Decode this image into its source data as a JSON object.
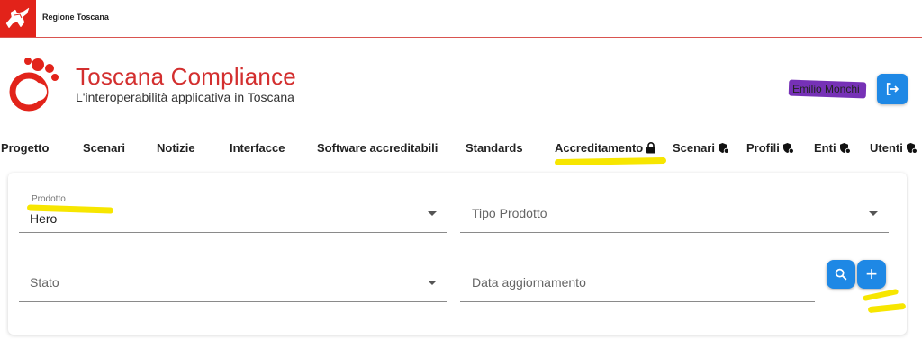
{
  "header": {
    "region_name": "Regione Toscana",
    "region_logo_icon": "pegasus-icon",
    "brand_title": "Toscana Compliance",
    "brand_subtitle": "L'interoperabilità applicativa in Toscana",
    "user_name": "Emilio Monchi"
  },
  "nav": {
    "items": [
      {
        "label": "Progetto"
      },
      {
        "label": "Scenari"
      },
      {
        "label": "Notizie"
      },
      {
        "label": "Interfacce"
      },
      {
        "label": "Software accreditabili"
      },
      {
        "label": "Standards"
      },
      {
        "label": "Accreditamento",
        "icon": "lock-icon"
      },
      {
        "label": "Scenari",
        "icon": "shield-icon"
      },
      {
        "label": "Profili",
        "icon": "shield-icon"
      },
      {
        "label": "Enti",
        "icon": "shield-icon"
      },
      {
        "label": "Utenti",
        "icon": "shield-icon"
      }
    ]
  },
  "filters": {
    "prodotto_label": "Prodotto",
    "prodotto_value": "Hero",
    "tipo_prodotto_placeholder": "Tipo Prodotto",
    "stato_placeholder": "Stato",
    "data_aggiornamento_placeholder": "Data aggiornamento",
    "search_icon": "search-icon",
    "add_label": "+"
  },
  "colors": {
    "brand_red": "#d32f2f",
    "region_red": "#e2231a",
    "button_blue": "#1e88e5",
    "highlight_yellow": "#f7e600",
    "scribble_purple": "#6a1fb0"
  }
}
